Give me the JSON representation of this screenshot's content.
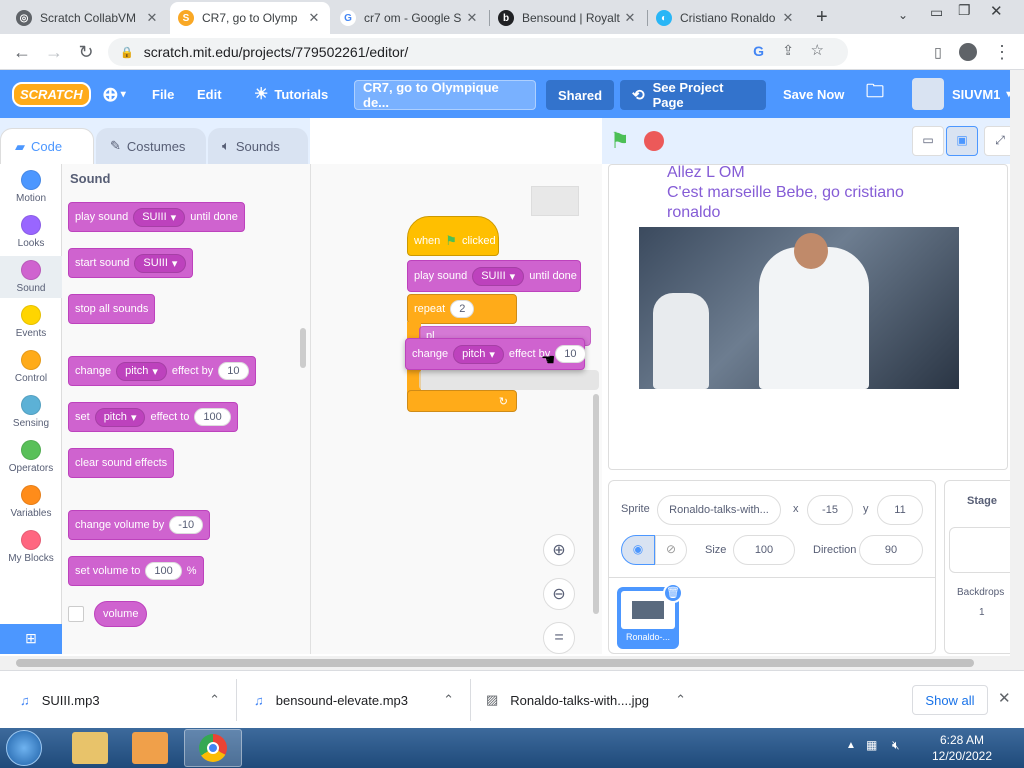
{
  "browser": {
    "tabs": [
      {
        "title": "Scratch CollabVM",
        "icon": "scratch-favicon",
        "active": false
      },
      {
        "title": "CR7, go to Olymp",
        "icon": "scratch-favicon",
        "active": true
      },
      {
        "title": "cr7 om - Google S",
        "icon": "google-icon",
        "active": false
      },
      {
        "title": "Bensound | Royalt",
        "icon": "bensound-icon",
        "active": false
      },
      {
        "title": "Cristiano Ronaldo",
        "icon": "web-icon",
        "active": false
      }
    ],
    "url": "scratch.mit.edu/projects/779502261/editor/"
  },
  "menubar": {
    "logo": "SCRATCH",
    "file": "File",
    "edit": "Edit",
    "tutorials": "Tutorials",
    "project_title": "CR7, go to Olympique de...",
    "shared": "Shared",
    "see_project": "See Project Page",
    "save_now": "Save Now",
    "username": "SIUVM1"
  },
  "editor_tabs": {
    "code": "Code",
    "costumes": "Costumes",
    "sounds": "Sounds"
  },
  "categories": [
    {
      "name": "Motion",
      "color": "#4c97ff"
    },
    {
      "name": "Looks",
      "color": "#9966ff"
    },
    {
      "name": "Sound",
      "color": "#cf63cf"
    },
    {
      "name": "Events",
      "color": "#ffd500"
    },
    {
      "name": "Control",
      "color": "#ffab19"
    },
    {
      "name": "Sensing",
      "color": "#5cb1d6"
    },
    {
      "name": "Operators",
      "color": "#59c059"
    },
    {
      "name": "Variables",
      "color": "#ff8c1a"
    },
    {
      "name": "My Blocks",
      "color": "#ff6680"
    }
  ],
  "palette": {
    "heading": "Sound",
    "play_sound": {
      "a": "play sound",
      "sound": "SUIII",
      "b": "until done"
    },
    "start_sound": {
      "a": "start sound",
      "sound": "SUIII"
    },
    "stop_all": "stop all sounds",
    "change_effect": {
      "a": "change",
      "effect": "pitch",
      "b": "effect by",
      "value": "10"
    },
    "set_effect": {
      "a": "set",
      "effect": "pitch",
      "b": "effect to",
      "value": "100"
    },
    "clear_effects": "clear sound effects",
    "change_volume": {
      "a": "change volume by",
      "value": "-10"
    },
    "set_volume": {
      "a": "set volume to",
      "value": "100",
      "unit": "%"
    },
    "volume": "volume"
  },
  "script": {
    "hat": {
      "a": "when",
      "b": "clicked"
    },
    "play": {
      "a": "play sound",
      "sound": "SUIII",
      "b": "until done"
    },
    "repeat": {
      "a": "repeat",
      "value": "2"
    },
    "hidden": "pl",
    "dragging": {
      "a": "change",
      "effect": "pitch",
      "b": "effect by",
      "value": "10"
    }
  },
  "stage_text": {
    "line1": "Allez L OM",
    "line2": "C'est marseille Bebe, go cristiano",
    "line3": "ronaldo"
  },
  "sprite_info": {
    "sprite_label": "Sprite",
    "sprite_name": "Ronaldo-talks-with...",
    "x_label": "x",
    "x": "-15",
    "y_label": "y",
    "y": "11",
    "show_label": "Show",
    "size_label": "Size",
    "size": "100",
    "direction_label": "Direction",
    "direction": "90",
    "thumb_name": "Ronaldo-..."
  },
  "stage_pane": {
    "title": "Stage",
    "backdrops_label": "Backdrops",
    "backdrops_count": "1"
  },
  "downloads": [
    {
      "name": "SUIII.mp3"
    },
    {
      "name": "bensound-elevate.mp3"
    },
    {
      "name": "Ronaldo-talks-with....jpg"
    }
  ],
  "downloads_show_all": "Show all",
  "taskbar": {
    "time": "6:28 AM",
    "date": "12/20/2022"
  }
}
